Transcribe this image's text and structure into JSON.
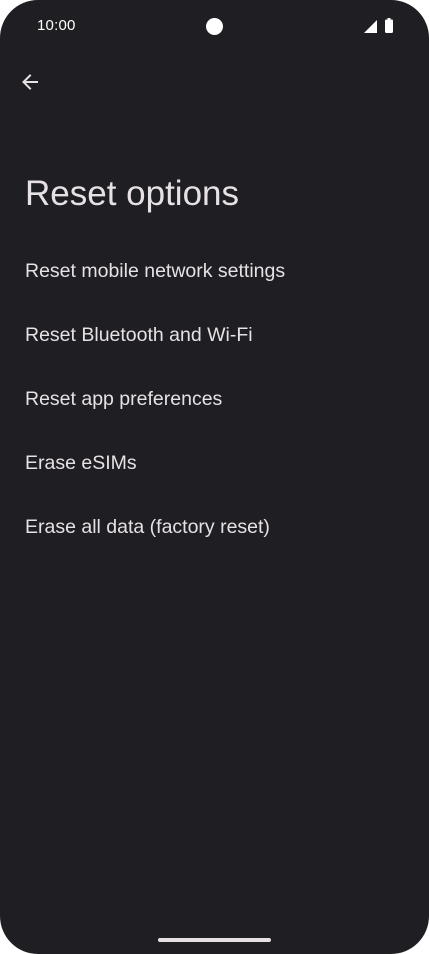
{
  "status_bar": {
    "time": "10:00"
  },
  "header": {
    "back_icon": "arrow-back-icon",
    "title": "Reset options"
  },
  "options": [
    {
      "label": "Reset mobile network settings"
    },
    {
      "label": "Reset Bluetooth and Wi-Fi"
    },
    {
      "label": "Reset app preferences"
    },
    {
      "label": "Erase eSIMs"
    },
    {
      "label": "Erase all data (factory reset)"
    }
  ],
  "colors": {
    "background": "#1f1e22",
    "text": "#e6e1e5",
    "status_icons": "#ffffff"
  }
}
